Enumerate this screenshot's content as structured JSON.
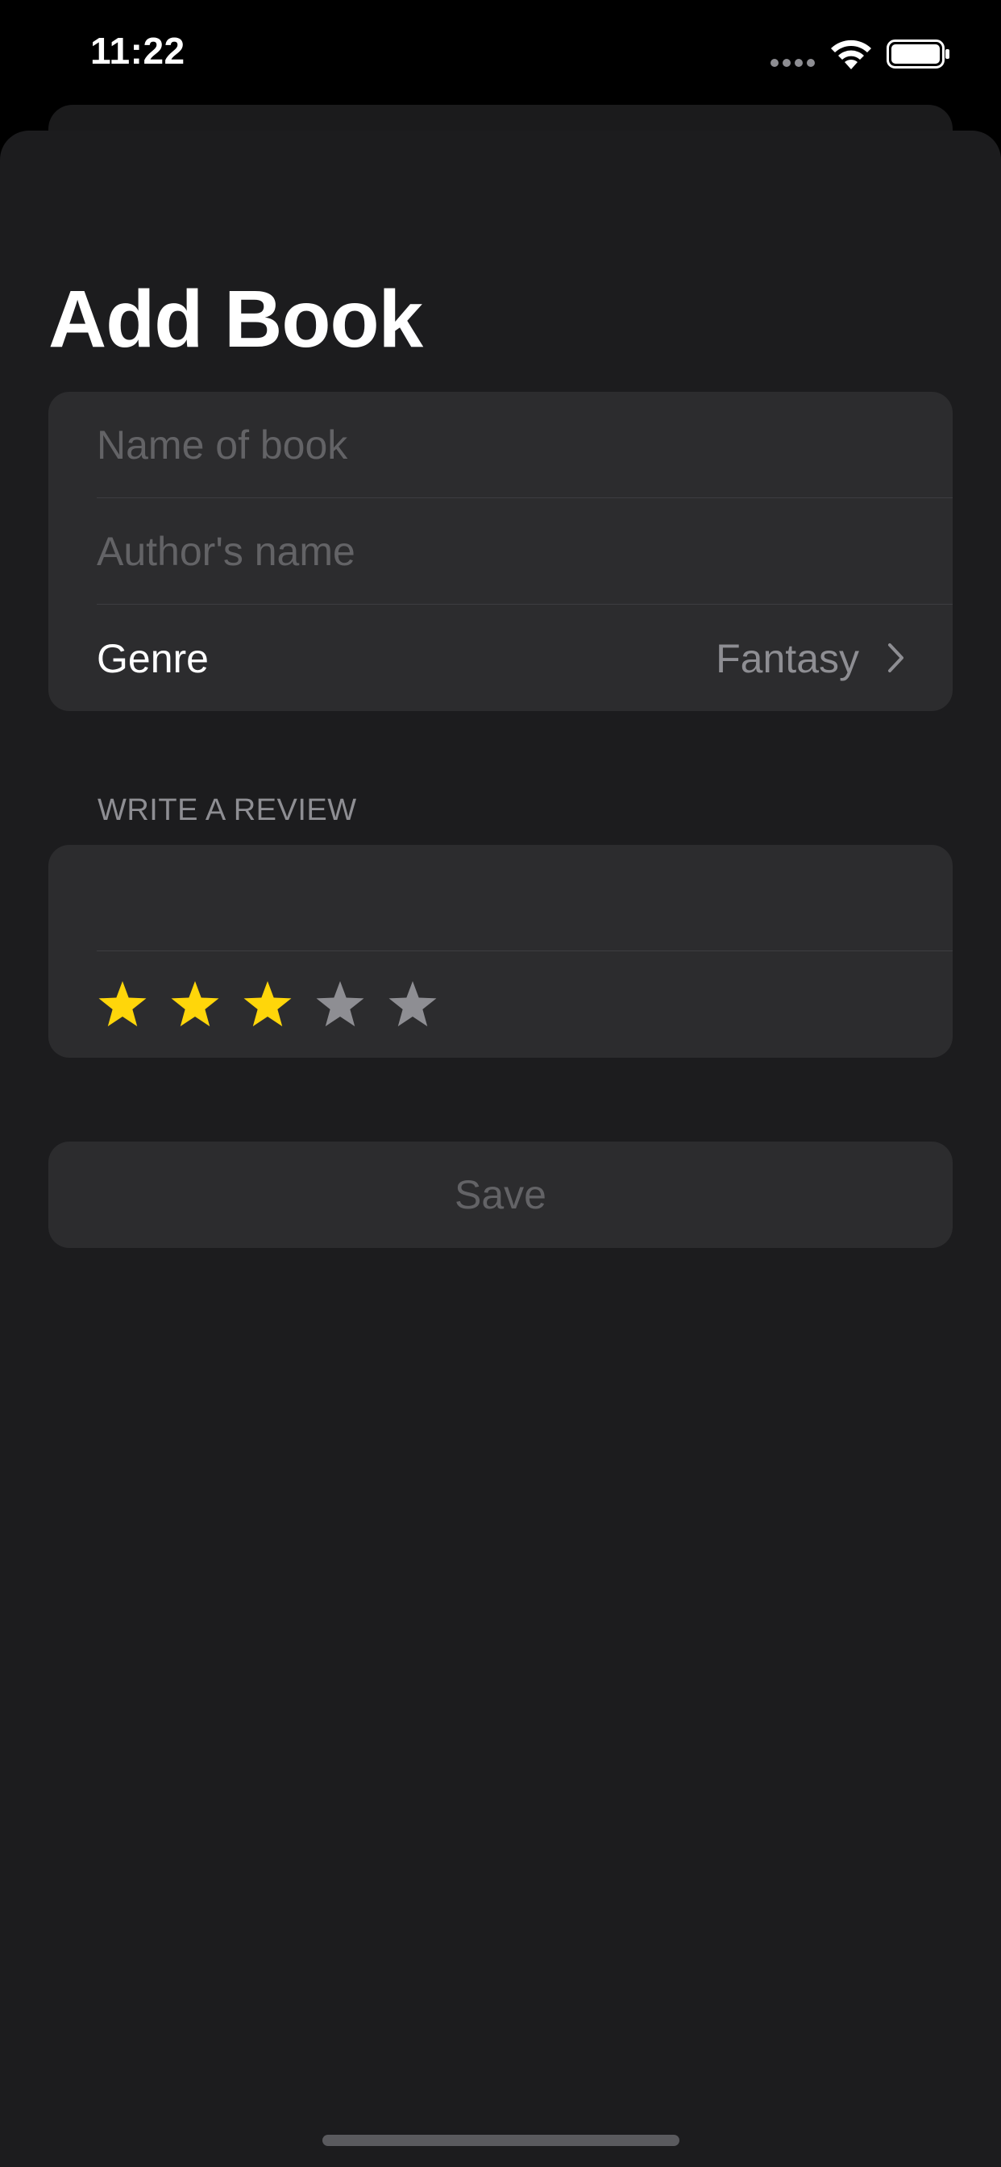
{
  "status_bar": {
    "time": "11:22",
    "signal_icon": "cellular-signal-dots",
    "wifi_icon": "wifi",
    "battery_icon": "battery-full"
  },
  "title": "Add Book",
  "form": {
    "name_placeholder": "Name of book",
    "name_value": "",
    "author_placeholder": "Author's name",
    "author_value": "",
    "genre_label": "Genre",
    "genre_value": "Fantasy",
    "chevron_icon": "chevron-right"
  },
  "review": {
    "section_header": "WRITE A REVIEW",
    "review_text": "",
    "rating": 3,
    "max_rating": 5,
    "star_icon": "star-fill"
  },
  "save_label": "Save",
  "colors": {
    "background": "#000000",
    "sheet": "#1c1c1e",
    "cell": "#2c2c2e",
    "star_on": "#ffd60a",
    "star_off": "#8e8e93",
    "placeholder": "#636366",
    "secondary_text": "#8e8e93"
  }
}
